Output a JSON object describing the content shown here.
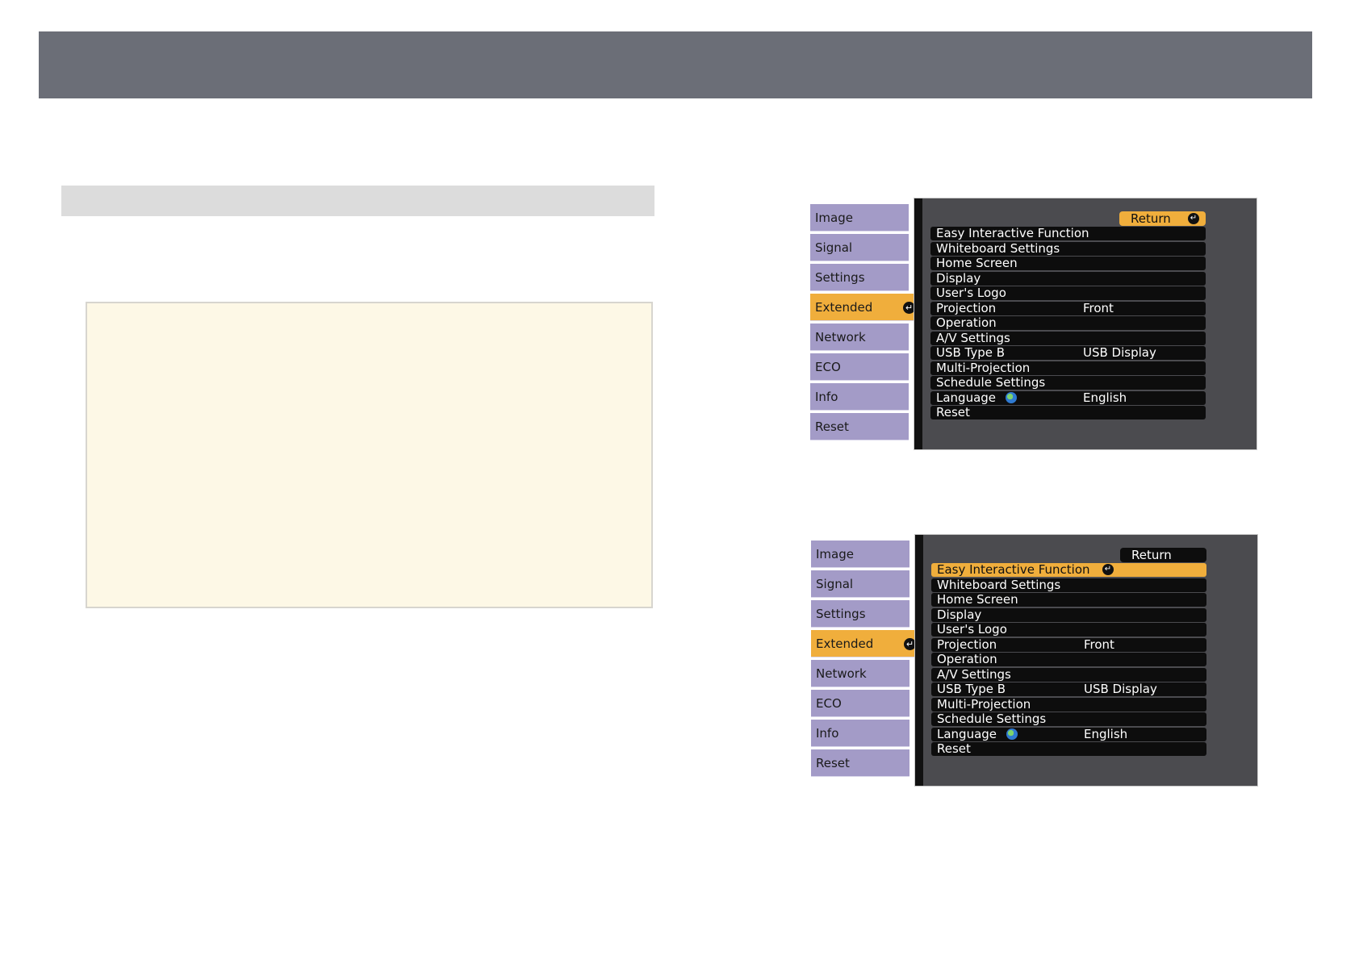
{
  "menus": [
    {
      "sidebar": [
        "Image",
        "Signal",
        "Settings",
        "Extended",
        "Network",
        "ECO",
        "Info",
        "Reset"
      ],
      "selected_sidebar": "Extended",
      "return_label": "Return",
      "return_highlighted": true,
      "rows": [
        {
          "label": "Easy Interactive Function",
          "value": ""
        },
        {
          "label": "Whiteboard Settings",
          "value": ""
        },
        {
          "label": "Home Screen",
          "value": ""
        },
        {
          "label": "Display",
          "value": ""
        },
        {
          "label": "User's Logo",
          "value": ""
        },
        {
          "label": "Projection",
          "value": "Front"
        },
        {
          "label": "Operation",
          "value": ""
        },
        {
          "label": "A/V Settings",
          "value": ""
        },
        {
          "label": "USB Type B",
          "value": "USB Display"
        },
        {
          "label": "Multi-Projection",
          "value": ""
        },
        {
          "label": "Schedule Settings",
          "value": ""
        },
        {
          "label": "Language",
          "value": "English"
        },
        {
          "label": "Reset",
          "value": ""
        }
      ],
      "selected_row": null
    },
    {
      "sidebar": [
        "Image",
        "Signal",
        "Settings",
        "Extended",
        "Network",
        "ECO",
        "Info",
        "Reset"
      ],
      "selected_sidebar": "Extended",
      "return_label": "Return",
      "return_highlighted": false,
      "rows": [
        {
          "label": "Easy Interactive Function",
          "value": ""
        },
        {
          "label": "Whiteboard Settings",
          "value": ""
        },
        {
          "label": "Home Screen",
          "value": ""
        },
        {
          "label": "Display",
          "value": ""
        },
        {
          "label": "User's Logo",
          "value": ""
        },
        {
          "label": "Projection",
          "value": "Front"
        },
        {
          "label": "Operation",
          "value": ""
        },
        {
          "label": "A/V Settings",
          "value": ""
        },
        {
          "label": "USB Type B",
          "value": "USB Display"
        },
        {
          "label": "Multi-Projection",
          "value": ""
        },
        {
          "label": "Schedule Settings",
          "value": ""
        },
        {
          "label": "Language",
          "value": "English"
        },
        {
          "label": "Reset",
          "value": ""
        }
      ],
      "selected_row": "Easy Interactive Function"
    }
  ],
  "colors": {
    "highlight": "#f0ae3c",
    "sidebar": "#a39bc7",
    "panel": "#4b4b4f",
    "row": "#0d0d0d"
  }
}
